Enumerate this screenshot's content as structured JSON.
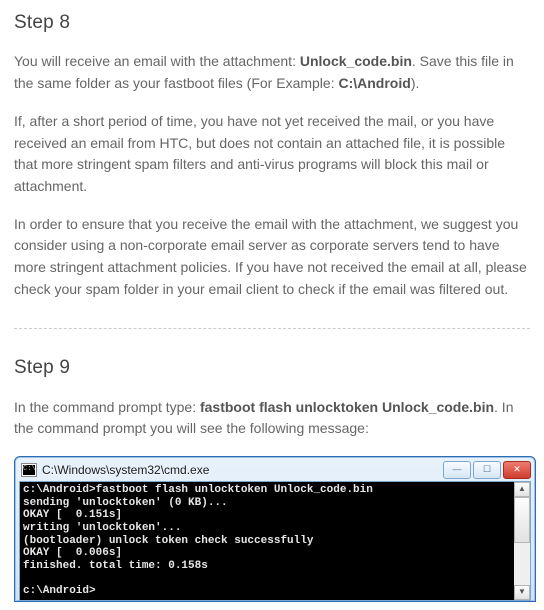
{
  "step8": {
    "title": "Step 8",
    "p1_a": "You will receive an email with the attachment: ",
    "p1_b": "Unlock_code.bin",
    "p1_c": ". Save this file in the same folder as your fastboot files (For Example: ",
    "p1_d": "C:\\Android",
    "p1_e": ").",
    "p2": "If, after a short period of time, you have not yet received the mail, or you have received an email from HTC, but does not contain an attached file, it is possible that more stringent spam filters and anti-virus programs will block this mail or attachment.",
    "p3": "In order to ensure that you receive the email with the attachment, we suggest you consider using a non-corporate email server as corporate servers tend to have more stringent attachment policies. If you have not received the email at all, please check your spam folder in your email client to check if the email was filtered out."
  },
  "step9": {
    "title": "Step 9",
    "p1_a": "In the command prompt type: ",
    "p1_b": "fastboot flash unlocktoken Unlock_code.bin",
    "p1_c": ". In the command prompt you will see the following message:"
  },
  "window": {
    "title": "C:\\Windows\\system32\\cmd.exe",
    "console": "c:\\Android>fastboot flash unlocktoken Unlock_code.bin\nsending 'unlocktoken' (0 KB)...\nOKAY [  0.151s]\nwriting 'unlocktoken'...\n(bootloader) unlock token check successfully\nOKAY [  0.006s]\nfinished. total time: 0.158s\n\nc:\\Android>"
  }
}
